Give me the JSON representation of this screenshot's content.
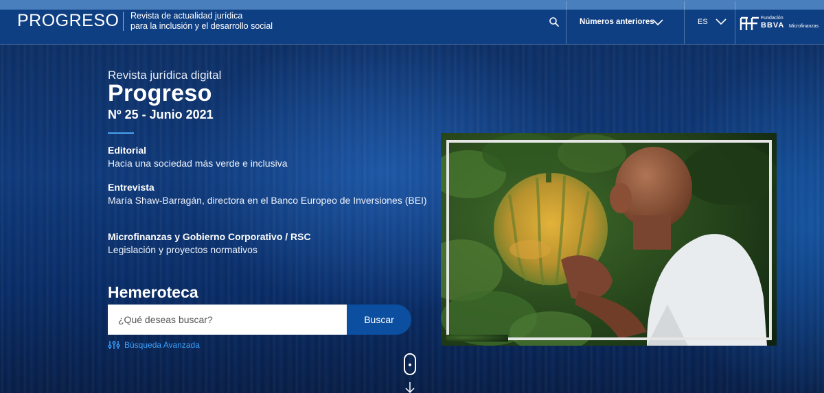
{
  "header": {
    "logo": "PROGRESO",
    "tagline_line1": "Revista de actualidad jurídica",
    "tagline_line2": "para la inclusión y el desarrollo social",
    "search_icon": "search-icon",
    "previous_issues_label": "Números anteriores",
    "language_label": "ES",
    "partner_small": "Fundación",
    "partner_big": "BBVA",
    "partner_micro": "Microfinanzas"
  },
  "hero": {
    "kicker": "Revista jurídica digital",
    "title": "Progreso",
    "issue": "Nº 25 - Junio 2021",
    "articles": [
      {
        "section": "Editorial",
        "title": "Hacia una sociedad más verde e inclusiva"
      },
      {
        "section": "Entrevista",
        "title": "María Shaw-Barragán, directora en el Banco Europeo de Inversiones (BEI)"
      },
      {
        "section": "Microfinanzas y Gobierno Corporativo / RSC",
        "title": "Legislación y proyectos normativos"
      }
    ]
  },
  "archive": {
    "heading": "Hemeroteca",
    "search_placeholder": "¿Qué deseas buscar?",
    "search_button": "Buscar",
    "advanced_search": "Búsqueda Avanzada"
  },
  "colors": {
    "header_bg": "#0f3f83",
    "accent_link": "#3ba3ff",
    "button_bg": "#0c4fa0"
  }
}
